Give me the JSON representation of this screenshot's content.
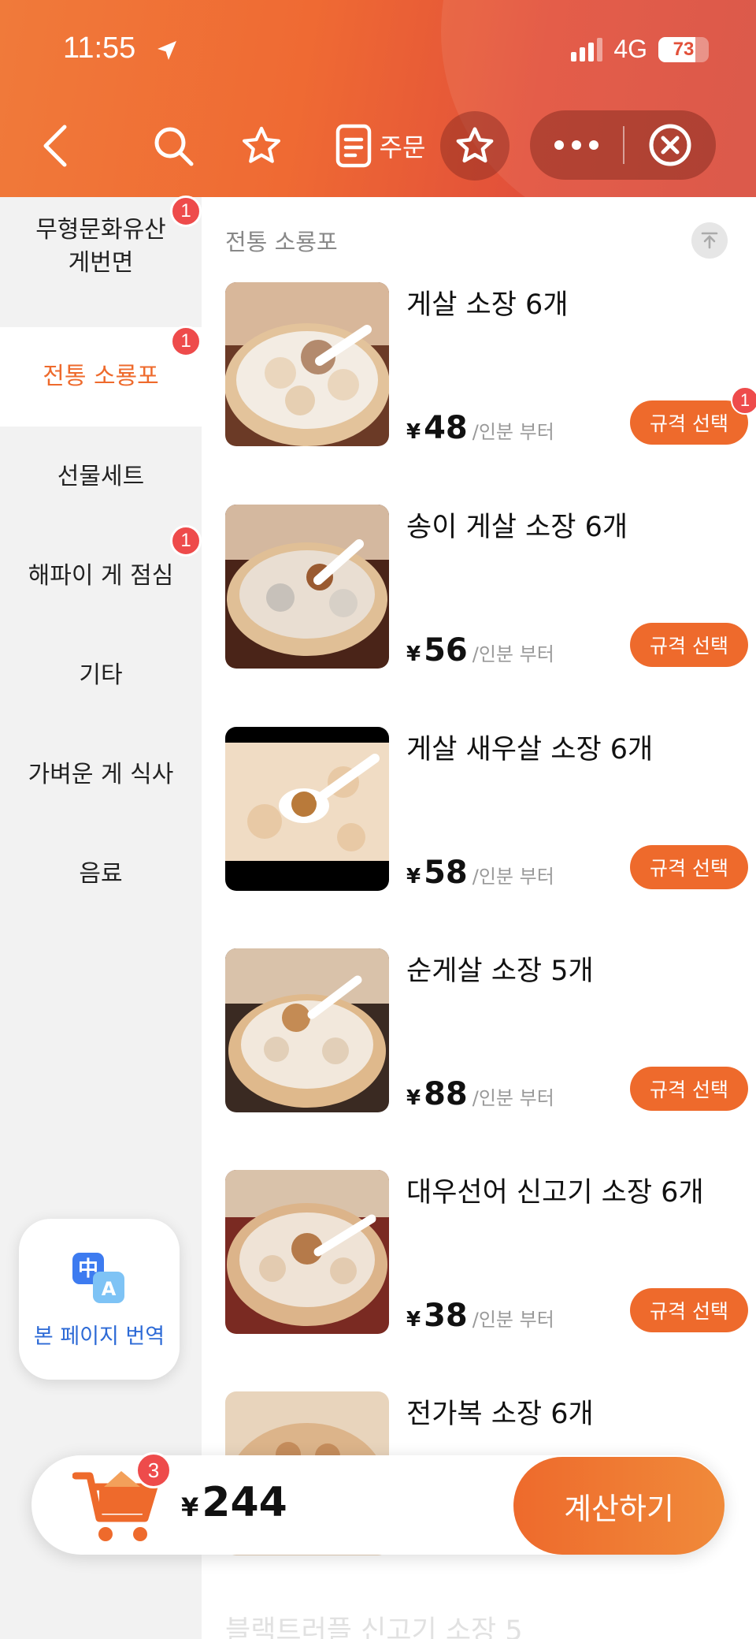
{
  "status_bar": {
    "time": "11:55",
    "network": "4G",
    "battery": "73",
    "battery_level": 0.73
  },
  "header": {
    "order_label": "주문"
  },
  "sidebar": {
    "items": [
      {
        "label": "무형문화유산\n게번면",
        "badge": "1"
      },
      {
        "label": "전통 소룡포",
        "badge": "1",
        "active": true
      },
      {
        "label": "선물세트",
        "badge": ""
      },
      {
        "label": "해파이 게 점심",
        "badge": "1"
      },
      {
        "label": "기타",
        "badge": ""
      },
      {
        "label": "가벼운 게 식사",
        "badge": ""
      },
      {
        "label": "음료",
        "badge": ""
      }
    ]
  },
  "translate": {
    "label": "본 페이지 번역",
    "icon_char_zh": "中",
    "icon_char_en": "A"
  },
  "section": {
    "title": "전통 소룡포"
  },
  "currency": "¥",
  "unit_label": "/인분 부터",
  "spec_button_label": "규격 선택",
  "products": [
    {
      "name": "게살 소장 6개",
      "price": "48",
      "badge": "1"
    },
    {
      "name": "송이 게살 소장 6개",
      "price": "56",
      "badge": ""
    },
    {
      "name": "게살 새우살 소장 6개",
      "price": "58",
      "badge": ""
    },
    {
      "name": "순게살 소장 5개",
      "price": "88",
      "badge": ""
    },
    {
      "name": "대우선어 신고기 소장 6개",
      "price": "38",
      "badge": ""
    },
    {
      "name": "전가복 소장 6개",
      "price": "",
      "badge": ""
    }
  ],
  "faded_next_item": "블랙트러플 신고기 소장 5",
  "cart": {
    "count": "3",
    "total": "244",
    "checkout_label": "계산하기"
  },
  "colors": {
    "accent": "#ee6a2c",
    "badge": "#ee4b4b",
    "link": "#2d6ad6"
  }
}
